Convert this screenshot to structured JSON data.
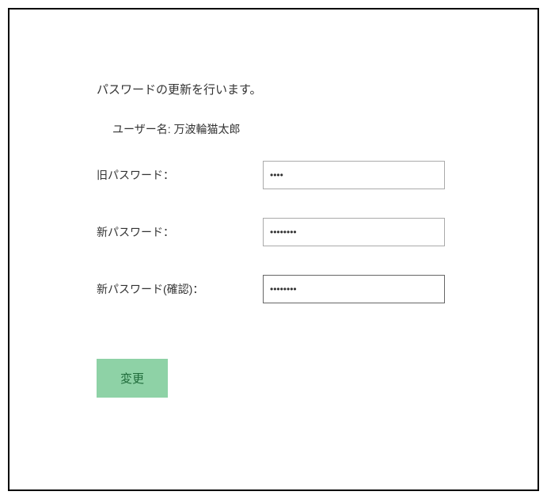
{
  "heading": "パスワードの更新を行います。",
  "username_label": "ユーザー名:",
  "username_value": "万波輪猫太郎",
  "fields": {
    "old_password": {
      "label": "旧パスワード：",
      "value": "••••"
    },
    "new_password": {
      "label": "新パスワード：",
      "value": "••••••••"
    },
    "confirm_password": {
      "label": "新パスワード(確認)：",
      "value": "••••••••"
    }
  },
  "submit_label": "変更"
}
